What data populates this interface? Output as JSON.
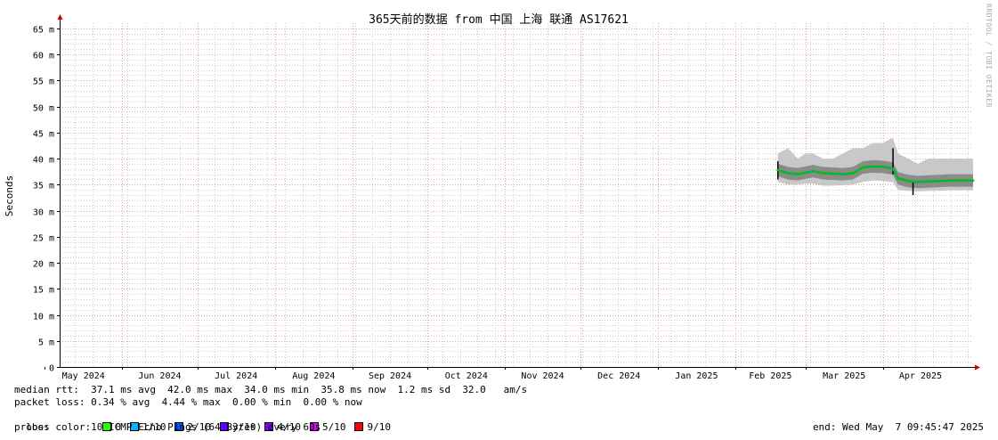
{
  "chart_data": {
    "type": "line",
    "title": "365天前的数据 from 中国 上海 联通 AS17621",
    "ylabel": "Seconds",
    "xlabel": "",
    "ylim": [
      0,
      0.066
    ],
    "y_ticks": [
      {
        "v": 0,
        "label": "0"
      },
      {
        "v": 0.005,
        "label": "5 m"
      },
      {
        "v": 0.01,
        "label": "10 m"
      },
      {
        "v": 0.015,
        "label": "15 m"
      },
      {
        "v": 0.02,
        "label": "20 m"
      },
      {
        "v": 0.025,
        "label": "25 m"
      },
      {
        "v": 0.03,
        "label": "30 m"
      },
      {
        "v": 0.035,
        "label": "35 m"
      },
      {
        "v": 0.04,
        "label": "40 m"
      },
      {
        "v": 0.045,
        "label": "45 m"
      },
      {
        "v": 0.05,
        "label": "50 m"
      },
      {
        "v": 0.055,
        "label": "55 m"
      },
      {
        "v": 0.06,
        "label": "60 m"
      },
      {
        "v": 0.065,
        "label": "65 m"
      }
    ],
    "x_range": [
      "2024-05-07",
      "2025-05-07"
    ],
    "x_ticks": [
      {
        "date": "2024-05-01",
        "label": "May 2024"
      },
      {
        "date": "2024-06-01",
        "label": "Jun 2024"
      },
      {
        "date": "2024-07-01",
        "label": "Jul 2024"
      },
      {
        "date": "2024-08-01",
        "label": "Aug 2024"
      },
      {
        "date": "2024-09-01",
        "label": "Sep 2024"
      },
      {
        "date": "2024-10-01",
        "label": "Oct 2024"
      },
      {
        "date": "2024-11-01",
        "label": "Nov 2024"
      },
      {
        "date": "2024-12-01",
        "label": "Dec 2024"
      },
      {
        "date": "2025-01-01",
        "label": "Jan 2025"
      },
      {
        "date": "2025-02-01",
        "label": "Feb 2025"
      },
      {
        "date": "2025-03-01",
        "label": "Mar 2025"
      },
      {
        "date": "2025-04-01",
        "label": "Apr 2025"
      }
    ],
    "series": [
      {
        "kind": "median",
        "points": [
          [
            "2025-02-18",
            0.0378
          ],
          [
            "2025-02-22",
            0.0372
          ],
          [
            "2025-02-26",
            0.037
          ],
          [
            "2025-03-01",
            0.0373
          ],
          [
            "2025-03-04",
            0.0376
          ],
          [
            "2025-03-08",
            0.0372
          ],
          [
            "2025-03-12",
            0.0371
          ],
          [
            "2025-03-16",
            0.037
          ],
          [
            "2025-03-20",
            0.0372
          ],
          [
            "2025-03-24",
            0.0383
          ],
          [
            "2025-03-28",
            0.0385
          ],
          [
            "2025-04-01",
            0.0384
          ],
          [
            "2025-04-05",
            0.0381
          ],
          [
            "2025-04-07",
            0.0362
          ],
          [
            "2025-04-11",
            0.0357
          ],
          [
            "2025-04-15",
            0.0355
          ],
          [
            "2025-04-19",
            0.0356
          ],
          [
            "2025-04-23",
            0.0357
          ],
          [
            "2025-04-27",
            0.0358
          ],
          [
            "2025-05-01",
            0.0358
          ],
          [
            "2025-05-07",
            0.0358
          ]
        ]
      },
      {
        "kind": "max_band",
        "points": [
          [
            "2025-02-18",
            0.041
          ],
          [
            "2025-02-22",
            0.042
          ],
          [
            "2025-02-26",
            0.04
          ],
          [
            "2025-03-01",
            0.041
          ],
          [
            "2025-03-04",
            0.041
          ],
          [
            "2025-03-08",
            0.04
          ],
          [
            "2025-03-12",
            0.04
          ],
          [
            "2025-03-16",
            0.041
          ],
          [
            "2025-03-20",
            0.042
          ],
          [
            "2025-03-24",
            0.042
          ],
          [
            "2025-03-28",
            0.043
          ],
          [
            "2025-04-01",
            0.043
          ],
          [
            "2025-04-05",
            0.044
          ],
          [
            "2025-04-07",
            0.041
          ],
          [
            "2025-04-11",
            0.04
          ],
          [
            "2025-04-15",
            0.039
          ],
          [
            "2025-04-19",
            0.04
          ],
          [
            "2025-04-23",
            0.04
          ],
          [
            "2025-04-27",
            0.04
          ],
          [
            "2025-05-01",
            0.04
          ],
          [
            "2025-05-07",
            0.04
          ]
        ]
      },
      {
        "kind": "min_band",
        "points": [
          [
            "2025-02-18",
            0.0355
          ],
          [
            "2025-02-22",
            0.035
          ],
          [
            "2025-02-26",
            0.035
          ],
          [
            "2025-03-01",
            0.0352
          ],
          [
            "2025-03-04",
            0.0352
          ],
          [
            "2025-03-08",
            0.0348
          ],
          [
            "2025-03-12",
            0.0348
          ],
          [
            "2025-03-16",
            0.0349
          ],
          [
            "2025-03-20",
            0.035
          ],
          [
            "2025-03-24",
            0.0355
          ],
          [
            "2025-03-28",
            0.0358
          ],
          [
            "2025-04-01",
            0.0357
          ],
          [
            "2025-04-05",
            0.0355
          ],
          [
            "2025-04-07",
            0.034
          ],
          [
            "2025-04-11",
            0.0338
          ],
          [
            "2025-04-15",
            0.0337
          ],
          [
            "2025-04-19",
            0.0338
          ],
          [
            "2025-04-23",
            0.0338
          ],
          [
            "2025-04-27",
            0.0339
          ],
          [
            "2025-05-01",
            0.0339
          ],
          [
            "2025-05-07",
            0.0339
          ]
        ]
      }
    ],
    "spikes": [
      {
        "date": "2025-02-18",
        "low": 0.036,
        "high": 0.0395
      },
      {
        "date": "2025-04-05",
        "low": 0.037,
        "high": 0.042
      },
      {
        "date": "2025-04-13",
        "low": 0.033,
        "high": 0.0355
      }
    ],
    "colors": {
      "axis": "#000000",
      "axis_arrow": "#cc0000",
      "grid_major": "#e6a0a0",
      "grid_minor": "#d0d0d0",
      "band": "#c8c8c8",
      "band_dark": "#777777",
      "median_green": "#00c000",
      "median_blue": "#00a0ff"
    }
  },
  "stats": {
    "median_rtt": "median rtt:  37.1 ms avg  42.0 ms max  34.0 ms min  35.8 ms now  1.2 ms sd  32.0   am/s",
    "packet_loss": "packet loss: 0.34 % avg  4.44 % max  0.00 % min  0.00 % now",
    "loss_color_label": "loss color:",
    "loss_colors": [
      {
        "label": "0",
        "color": "#26ff00"
      },
      {
        "label": "1/10",
        "color": "#00b8ff"
      },
      {
        "label": "2/10",
        "color": "#0059ff"
      },
      {
        "label": "3/10",
        "color": "#5e00ff"
      },
      {
        "label": "4/10",
        "color": "#7e00ff"
      },
      {
        "label": "5/10",
        "color": "#dd00ff"
      },
      {
        "label": "9/10",
        "color": "#ff0000"
      }
    ],
    "probe": "probe:       10 ICMP Echo Pings (64 Bytes) every 60s",
    "end": "end: Wed May  7 09:45:47 2025"
  },
  "watermark": "RRDTOOL / TOBI OETIKER"
}
